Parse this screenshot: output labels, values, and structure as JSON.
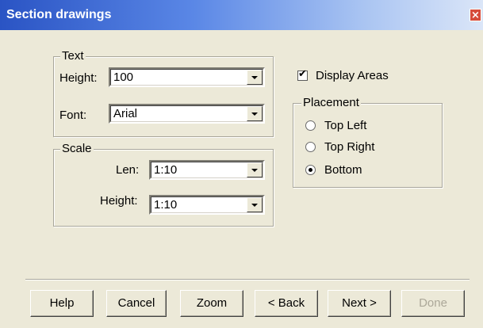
{
  "window": {
    "title": "Section drawings",
    "close_glyph": "×"
  },
  "text_group": {
    "legend": "Text",
    "height_label": "Height:",
    "height_value": "100",
    "font_label": "Font:",
    "font_value": "Arial"
  },
  "scale_group": {
    "legend": "Scale",
    "len_label": "Len:",
    "len_value": "1:10",
    "height_label": "Height:",
    "height_value": "1:10"
  },
  "display_areas": {
    "label": "Display Areas",
    "checked": true,
    "check_glyph": "✔"
  },
  "placement_group": {
    "legend": "Placement",
    "options": [
      "Top Left",
      "Top Right",
      "Bottom"
    ],
    "selected": "Bottom"
  },
  "buttons": {
    "help": "Help",
    "cancel": "Cancel",
    "zoom": "Zoom",
    "back": "< Back",
    "next": "Next >",
    "done": "Done"
  },
  "icons": {
    "close": "close-icon",
    "dropdown": "chevron-down-icon"
  }
}
